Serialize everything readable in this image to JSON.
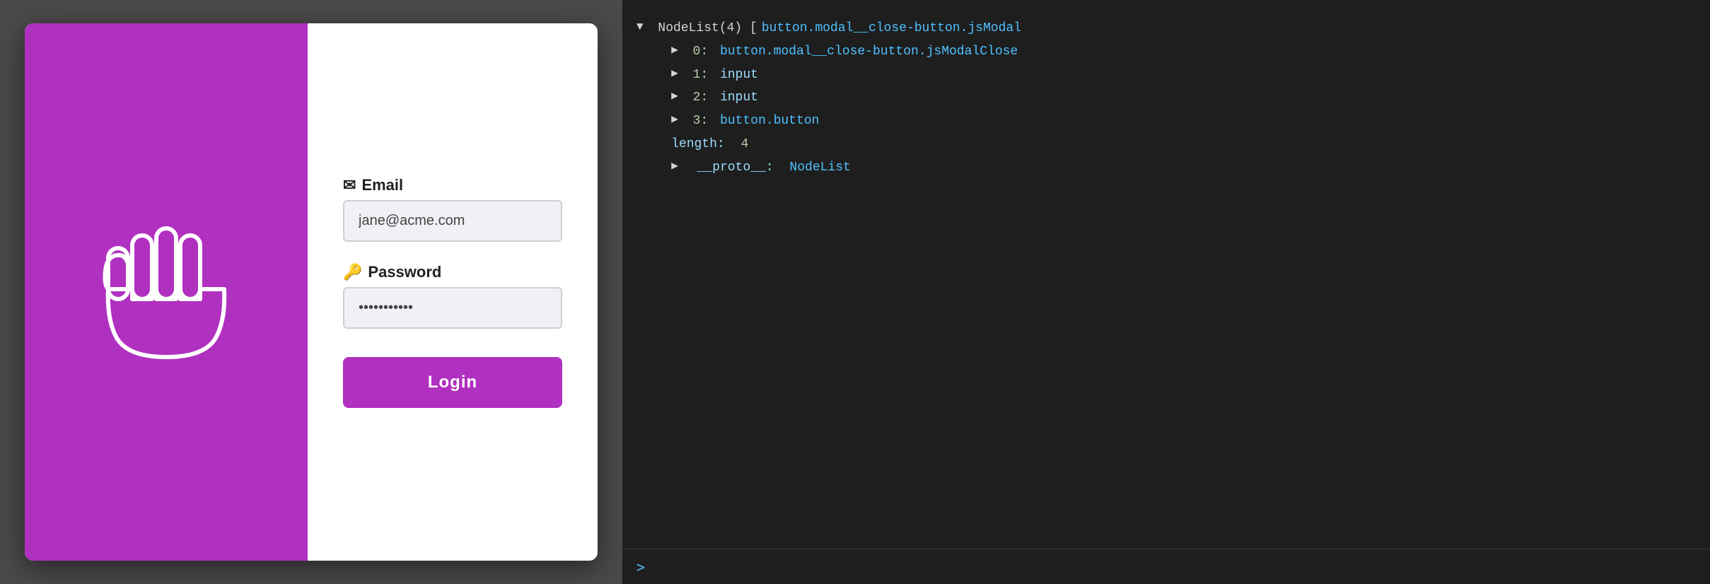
{
  "modal": {
    "email_label": "Email",
    "email_icon": "✉",
    "email_placeholder": "jane@acme.com",
    "email_value": "jane@acme.com",
    "password_label": "Password",
    "password_icon": "🔑",
    "password_value": "········",
    "login_button_label": "Login"
  },
  "devtools": {
    "line1": "▼ NodeList(4) [button.modal__close-button.jsModal",
    "line1_prefix": "▼",
    "line1_text_white": " NodeList(4) [",
    "line1_text_blue": "button.modal__close-button.jsModal",
    "item0_index": "0:",
    "item0_value": "button.modal__close-button.jsModalClose",
    "item1_index": "1:",
    "item1_value": "input",
    "item2_index": "2:",
    "item2_value": "input",
    "item3_index": "3:",
    "item3_value": "button.button",
    "length_key": "length:",
    "length_value": "4",
    "proto_key": "__proto__:",
    "proto_value": "NodeList",
    "prompt_caret": ">"
  },
  "colors": {
    "purple": "#b030c0",
    "devtools_bg": "#1e1e1e",
    "devtools_blue": "#4fc1ff",
    "devtools_cyan": "#9cdcfe"
  }
}
